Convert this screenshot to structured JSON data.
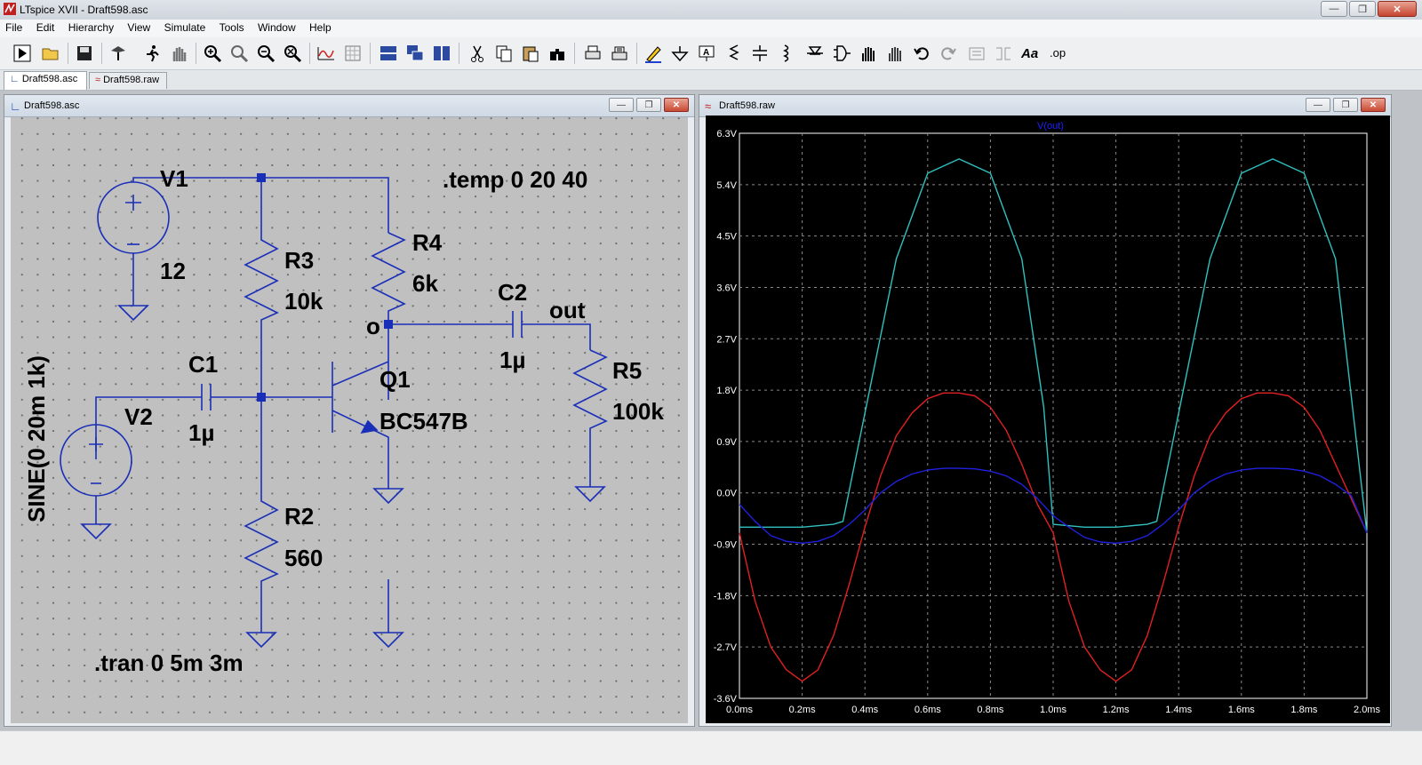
{
  "window": {
    "title": "LTspice XVII - Draft598.asc"
  },
  "menu": [
    "File",
    "Edit",
    "Hierarchy",
    "View",
    "Simulate",
    "Tools",
    "Window",
    "Help"
  ],
  "toolbar": {
    "icons": [
      "run-icon",
      "open-icon",
      "save-icon",
      "control-panel-icon",
      "run-man-icon",
      "halt-hand-icon",
      "zoom-in-icon",
      "zoom-pan-icon",
      "zoom-out-icon",
      "zoom-cancel-icon",
      "autorange-icon",
      "grid-icon",
      "tile-horizontal-icon",
      "cascade-icon",
      "tile-icon",
      "cut-icon",
      "copy-icon",
      "paste-icon",
      "find-icon",
      "print-icon",
      "print-setup-icon",
      "draw-wire-icon",
      "ground-icon",
      "label-net-icon",
      "resistor-icon",
      "capacitor-icon",
      "inductor-icon",
      "diode-icon",
      "component-icon",
      "move-icon",
      "drag-icon",
      "undo-icon",
      "redo-icon",
      "rotate-icon",
      "mirror-icon",
      "text-icon",
      "spice-directive-icon"
    ],
    "op_label": ".op",
    "text_label": "Aa"
  },
  "tabs": [
    {
      "label": "Draft598.asc",
      "active": true
    },
    {
      "label": "Draft598.raw",
      "active": false
    }
  ],
  "schematic_window": {
    "title": "Draft598.asc"
  },
  "schematic": {
    "labels": {
      "v1": "V1",
      "v1_value": "12",
      "r3": "R3",
      "r3_value": "10k",
      "r4": "R4",
      "r4_value": "6k",
      "c2": "C2",
      "c2_value": "1µ",
      "out": "out",
      "o": "o",
      "c1": "C1",
      "c1_value": "1µ",
      "q1": "Q1",
      "q1_value": "BC547B",
      "r5": "R5",
      "r5_value": "100k",
      "v2": "V2",
      "v2_value": "SINE(0 20m 1k)",
      "r2": "R2",
      "r2_value": "560",
      "temp_directive": ".temp 0 20 40",
      "tran_directive": ".tran 0 5m 3m"
    }
  },
  "plot_window": {
    "title": "Draft598.raw"
  },
  "chart_data": {
    "type": "line",
    "title": "V(out)",
    "xlabel": "",
    "ylabel": "",
    "x_ticks": [
      "0.0ms",
      "0.2ms",
      "0.4ms",
      "0.6ms",
      "0.8ms",
      "1.0ms",
      "1.2ms",
      "1.4ms",
      "1.6ms",
      "1.8ms",
      "2.0ms"
    ],
    "y_ticks": [
      "6.3V",
      "5.4V",
      "4.5V",
      "3.6V",
      "2.7V",
      "1.8V",
      "0.9V",
      "0.0V",
      "-0.9V",
      "-1.8V",
      "-2.7V",
      "-3.6V"
    ],
    "xlim": [
      0,
      2.0
    ],
    "ylim": [
      -3.6,
      6.3
    ],
    "grid": true,
    "background": "#000000",
    "series": [
      {
        "color": "#30c0c0",
        "x": [
          0,
          0.1,
          0.2,
          0.3,
          0.33,
          0.4,
          0.5,
          0.6,
          0.7,
          0.8,
          0.9,
          0.97,
          1.0,
          1.1,
          1.2,
          1.3,
          1.33,
          1.4,
          1.5,
          1.6,
          1.7,
          1.8,
          1.9,
          2.0
        ],
        "y": [
          -0.6,
          -0.6,
          -0.6,
          -0.55,
          -0.5,
          1.4,
          4.1,
          5.6,
          5.85,
          5.6,
          4.1,
          1.5,
          -0.55,
          -0.6,
          -0.6,
          -0.55,
          -0.5,
          1.4,
          4.1,
          5.6,
          5.85,
          5.6,
          4.1,
          -0.7
        ]
      },
      {
        "color": "#e02020",
        "x": [
          0,
          0.05,
          0.1,
          0.15,
          0.2,
          0.25,
          0.3,
          0.35,
          0.4,
          0.45,
          0.5,
          0.55,
          0.6,
          0.65,
          0.7,
          0.75,
          0.8,
          0.85,
          0.9,
          0.95,
          1.0,
          1.05,
          1.1,
          1.15,
          1.2,
          1.25,
          1.3,
          1.35,
          1.4,
          1.45,
          1.5,
          1.55,
          1.6,
          1.65,
          1.7,
          1.75,
          1.8,
          1.85,
          1.9,
          1.95,
          2.0
        ],
        "y": [
          -0.7,
          -1.9,
          -2.7,
          -3.1,
          -3.3,
          -3.1,
          -2.5,
          -1.6,
          -0.6,
          0.3,
          1.0,
          1.4,
          1.65,
          1.75,
          1.75,
          1.7,
          1.5,
          1.1,
          0.5,
          -0.2,
          -0.7,
          -1.9,
          -2.7,
          -3.1,
          -3.3,
          -3.1,
          -2.5,
          -1.6,
          -0.6,
          0.3,
          1.0,
          1.4,
          1.65,
          1.75,
          1.75,
          1.7,
          1.5,
          1.1,
          0.5,
          -0.1,
          -0.7
        ]
      },
      {
        "color": "#2020e0",
        "x": [
          0,
          0.05,
          0.1,
          0.15,
          0.2,
          0.25,
          0.3,
          0.35,
          0.4,
          0.45,
          0.5,
          0.55,
          0.6,
          0.65,
          0.7,
          0.75,
          0.8,
          0.85,
          0.9,
          0.95,
          1.0,
          1.05,
          1.1,
          1.15,
          1.2,
          1.25,
          1.3,
          1.35,
          1.4,
          1.45,
          1.5,
          1.55,
          1.6,
          1.65,
          1.7,
          1.75,
          1.8,
          1.85,
          1.9,
          1.95,
          2.0
        ],
        "y": [
          -0.2,
          -0.5,
          -0.75,
          -0.85,
          -0.88,
          -0.85,
          -0.75,
          -0.55,
          -0.3,
          0.0,
          0.2,
          0.33,
          0.4,
          0.43,
          0.43,
          0.42,
          0.38,
          0.3,
          0.15,
          -0.1,
          -0.4,
          -0.6,
          -0.78,
          -0.86,
          -0.88,
          -0.85,
          -0.75,
          -0.55,
          -0.3,
          0.0,
          0.2,
          0.33,
          0.4,
          0.43,
          0.43,
          0.42,
          0.38,
          0.3,
          0.15,
          -0.05,
          -0.7
        ]
      }
    ]
  }
}
